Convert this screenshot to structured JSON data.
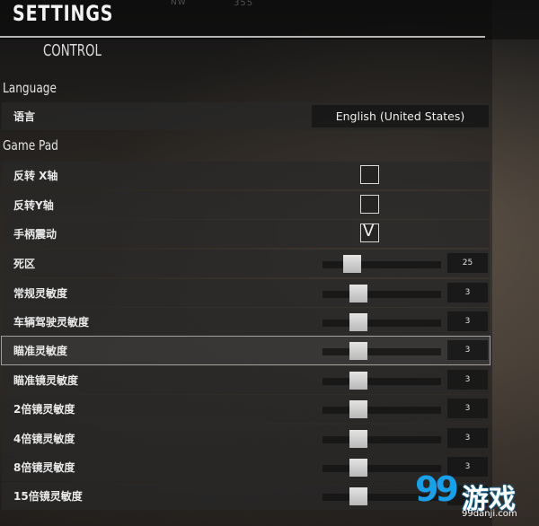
{
  "header": {
    "title": "SETTINGS",
    "tab": "CONTROL",
    "compass": [
      "NW",
      "355"
    ]
  },
  "language": {
    "section": "Language",
    "row_label": "语言",
    "selected": "English (United States)"
  },
  "gamepad": {
    "section": "Game Pad",
    "checkboxes": [
      {
        "label": "反转 X轴",
        "checked": false
      },
      {
        "label": "反转Y轴",
        "checked": false
      },
      {
        "label": "手柄震动",
        "checked": true,
        "mark": "V"
      }
    ],
    "sliders": [
      {
        "label": "死区",
        "value": "25",
        "level": 0.25
      },
      {
        "label": "常规灵敏度",
        "value": "3",
        "level": 0.3
      },
      {
        "label": "车辆驾驶灵敏度",
        "value": "3",
        "level": 0.3
      },
      {
        "label": "瞄准灵敏度",
        "value": "3",
        "level": 0.3,
        "highlighted": true
      },
      {
        "label": "瞄准镜灵敏度",
        "value": "3",
        "level": 0.3
      },
      {
        "label": "2倍镜灵敏度",
        "value": "3",
        "level": 0.3
      },
      {
        "label": "4倍镜灵敏度",
        "value": "3",
        "level": 0.3
      },
      {
        "label": "8倍镜灵敏度",
        "value": "3",
        "level": 0.3
      },
      {
        "label": "15倍镜灵敏度",
        "value": "3",
        "level": 0.3
      }
    ]
  },
  "watermark": {
    "digits": "99",
    "text": "游戏",
    "url": "99danji.com"
  }
}
